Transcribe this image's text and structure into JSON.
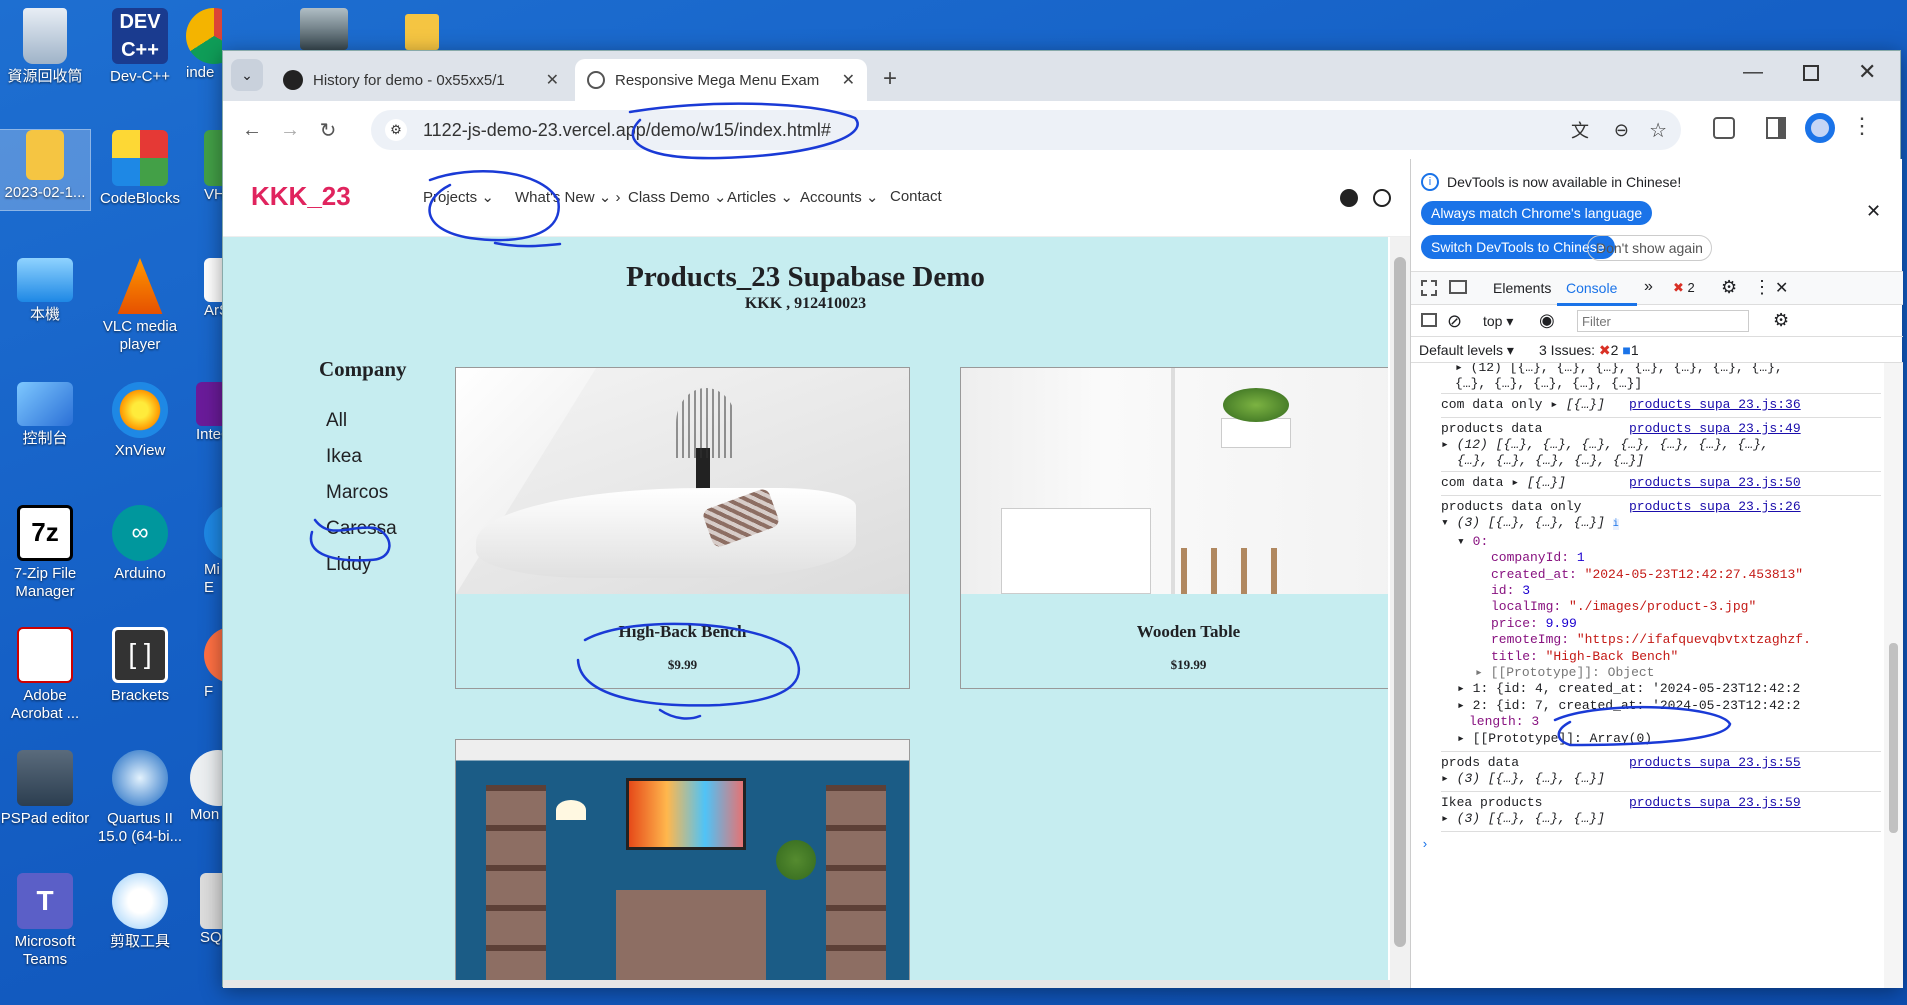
{
  "desktop": {
    "icons": [
      {
        "label": "資源回收筒"
      },
      {
        "label": "Dev-C++"
      },
      {
        "label": "inde"
      },
      {
        "label": "2023-02-1..."
      },
      {
        "label": "CodeBlocks"
      },
      {
        "label": "VH"
      },
      {
        "label": "本機"
      },
      {
        "label": "VLC media player"
      },
      {
        "label": "ArS"
      },
      {
        "label": "控制台"
      },
      {
        "label": "XnView"
      },
      {
        "label": "InteCor"
      },
      {
        "label": "7-Zip File Manager"
      },
      {
        "label": "Arduino"
      },
      {
        "label": "Mi E"
      },
      {
        "label": "Adobe Acrobat ..."
      },
      {
        "label": "Brackets"
      },
      {
        "label": "F"
      },
      {
        "label": "PSPad editor"
      },
      {
        "label": "Quartus II 15.0 (64-bi..."
      },
      {
        "label": "Mon"
      },
      {
        "label": "Microsoft Teams"
      },
      {
        "label": "剪取工具"
      },
      {
        "label": "SQ"
      }
    ]
  },
  "browser": {
    "tabs": [
      {
        "title": "History for demo - 0x55xx5/1"
      },
      {
        "title": "Responsive Mega Menu Exam"
      }
    ],
    "address": "1122-js-demo-23.vercel.app/demo/w15/index.html#"
  },
  "site": {
    "brand": "KKK_23",
    "nav": [
      "Projects",
      "What's New",
      "Class Demo",
      "Articles",
      "Accounts",
      "Contact"
    ],
    "heading": "Products_23 Supabase Demo",
    "subheading": "KKK , 912410023",
    "sidebar_title": "Company",
    "companies": [
      "All",
      "Ikea",
      "Marcos",
      "Caressa",
      "Liddy"
    ],
    "products": [
      {
        "title": "High-Back Bench",
        "price": "$9.99"
      },
      {
        "title": "Wooden Table",
        "price": "$19.99"
      }
    ]
  },
  "devtools": {
    "notice": "DevTools is now available in Chinese!",
    "btn_match": "Always match Chrome's language",
    "btn_switch": "Switch DevTools to Chinese",
    "btn_dont": "Don't show again",
    "tab_elements": "Elements",
    "tab_console": "Console",
    "error_count": "2",
    "context": "top",
    "filter_placeholder": "Filter",
    "default_levels": "Default levels",
    "issues_label": "3 Issues:",
    "issues_err": "2",
    "issues_info": "1",
    "entries": {
      "top_line1": "(12) [{…}, {…}, {…}, {…}, {…}, {…}, {…},",
      "top_line2": "{…}, {…}, {…}, {…}, {…}]",
      "com_only_label": "com data only",
      "com_only_val": "[{…}]",
      "com_only_src": "products_supa_23.js:36",
      "products_label": "products data",
      "products_src": "products_supa_23.js:49",
      "products_l1": "(12) [{…}, {…}, {…}, {…}, {…}, {…}, {…},",
      "products_l2": "{…}, {…}, {…}, {…}, {…}]",
      "com_label": "com data",
      "com_val": "[{…}]",
      "com_src": "products_supa_23.js:50",
      "pdo_label": "products data only",
      "pdo_src": "products_supa_23.js:26",
      "pdo_val": "(3) [{…}, {…}, {…}]",
      "idx0": "0:",
      "f_companyId_k": "companyId:",
      "f_companyId_v": "1",
      "f_created_k": "created_at:",
      "f_created_v": "\"2024-05-23T12:42:27.453813\"",
      "f_id_k": "id:",
      "f_id_v": "3",
      "f_local_k": "localImg:",
      "f_local_v": "\"./images/product-3.jpg\"",
      "f_price_k": "price:",
      "f_price_v": "9.99",
      "f_remote_k": "remoteImg:",
      "f_remote_v": "\"https://ifafquevqbvtxtzaghzf.",
      "f_title_k": "title:",
      "f_title_v": "\"High-Back Bench\"",
      "proto_obj": "[[Prototype]]: Object",
      "row1": "1: {id: 4, created_at: '2024-05-23T12:42:2",
      "row2": "2: {id: 7, created_at: '2024-05-23T12:42:2",
      "length": "length: 3",
      "proto_arr": "[[Prototype]]: Array(0)",
      "prods_label": "prods data",
      "prods_src": "products_supa_23.js:55",
      "prods_val": "(3) [{…}, {…}, {…}]",
      "ikea_label": "Ikea products",
      "ikea_src": "products_supa_23.js:59",
      "ikea_val": "(3) [{…}, {…}, {…}]"
    }
  },
  "colors": {
    "brand": "#e0245e",
    "page_bg": "#c6edf0",
    "accent": "#1a73e8",
    "ink": "#1a3ad6"
  }
}
